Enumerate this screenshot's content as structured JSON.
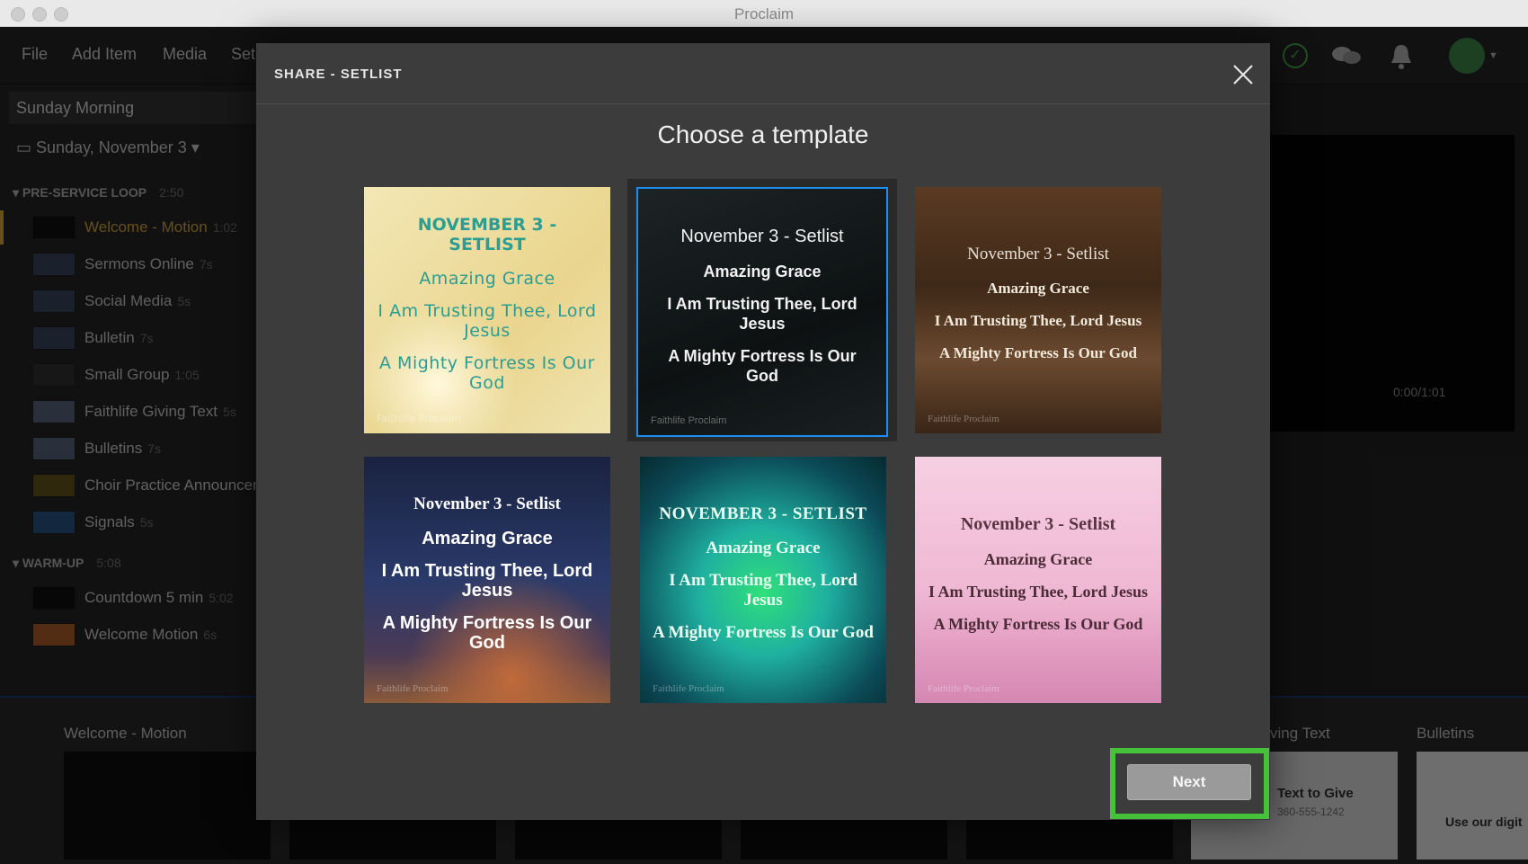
{
  "window": {
    "title": "Proclaim"
  },
  "menu": {
    "items": [
      "File",
      "Add Item",
      "Media",
      "Set"
    ]
  },
  "sidebar": {
    "service_name": "Sunday Morning",
    "date": "Sunday, November 3",
    "sections": [
      {
        "name": "PRE-SERVICE LOOP",
        "duration": "2:50",
        "items": [
          {
            "label": "Welcome - Motion",
            "duration": "1:02"
          },
          {
            "label": "Sermons Online",
            "duration": "7s"
          },
          {
            "label": "Social Media",
            "duration": "5s"
          },
          {
            "label": "Bulletin",
            "duration": "7s"
          },
          {
            "label": "Small Group",
            "duration": "1:05"
          },
          {
            "label": "Faithlife Giving Text",
            "duration": "5s"
          },
          {
            "label": "Bulletins",
            "duration": "7s"
          },
          {
            "label": "Choir Practice Announcem",
            "duration": ""
          },
          {
            "label": "Signals",
            "duration": "5s"
          }
        ]
      },
      {
        "name": "WARM-UP",
        "duration": "5:08",
        "items": [
          {
            "label": "Countdown 5 min",
            "duration": "5:02"
          },
          {
            "label": "Welcome Motion",
            "duration": "6s"
          }
        ]
      }
    ]
  },
  "preview": {
    "time": "0:00/1:01"
  },
  "bottom": {
    "current_title": "Welcome - Motion",
    "right_title_partial": "ving Text",
    "right_title_2": "Bulletins",
    "card1": {
      "title": "Text to Give",
      "phone": "360-555-1242"
    },
    "card2": {
      "title": "Use our digit"
    }
  },
  "modal": {
    "title": "SHARE - SETLIST",
    "heading": "Choose a template",
    "next_label": "Next",
    "watermark": "Faithlife Proclaim",
    "templates": [
      {
        "header": "NOVEMBER 3 - SETLIST",
        "songs": [
          "Amazing Grace",
          "I Am Trusting Thee, Lord Jesus",
          "A Mighty Fortress Is Our God"
        ]
      },
      {
        "header": "November 3 - Setlist",
        "songs": [
          "Amazing Grace",
          "I Am Trusting Thee, Lord Jesus",
          "A Mighty Fortress Is Our God"
        ]
      },
      {
        "header": "November 3 - Setlist",
        "songs": [
          "Amazing Grace",
          "I Am Trusting Thee, Lord Jesus",
          "A Mighty Fortress Is Our God"
        ]
      },
      {
        "header": "November 3 - Setlist",
        "songs": [
          "Amazing Grace",
          "I Am Trusting Thee, Lord Jesus",
          "A Mighty Fortress Is Our God"
        ]
      },
      {
        "header": "NOVEMBER 3 - SETLIST",
        "songs": [
          "Amazing Grace",
          "I Am Trusting Thee, Lord Jesus",
          "A Mighty Fortress Is Our God"
        ]
      },
      {
        "header": "November 3 - Setlist",
        "songs": [
          "Amazing Grace",
          "I Am Trusting Thee, Lord Jesus",
          "A Mighty Fortress Is Our God"
        ]
      }
    ],
    "selected_index": 1
  },
  "colors": {
    "selected_border": "#1b8ef0",
    "highlight": "#45c23a",
    "accent_active": "#e0b13a"
  }
}
